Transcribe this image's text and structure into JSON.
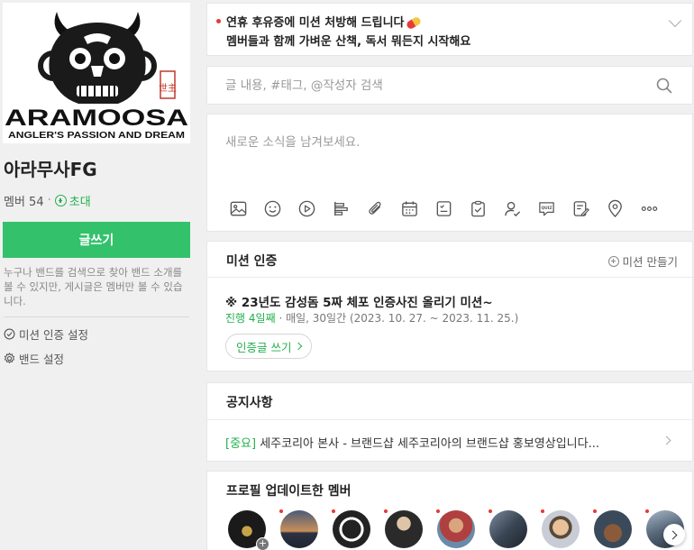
{
  "band": {
    "logo_text": "ARAMOOSA",
    "logo_tagline": "ANGLER'S PASSION AND DREAM",
    "logo_seal": "世主",
    "name": "아라무사FG",
    "member_label": "멤버 54",
    "invite_label": "초대",
    "write_button": "글쓰기",
    "description": "누구나 밴드를 검색으로 찾아 밴드 소개를 볼 수 있지만, 게시글은 멤버만 볼 수 있습니다.",
    "mission_setting": "미션 인증 설정",
    "band_setting": "밴드 설정"
  },
  "banner": {
    "line1": "연휴 후유증에 미션 처방해 드립니다",
    "line2": "멤버들과 함께 가벼운 산책, 독서 뭐든지 시작해요"
  },
  "search": {
    "placeholder": "글 내용, #태그, @작성자 검색"
  },
  "compose": {
    "placeholder": "새로운 소식을 남겨보세요.",
    "tools": [
      "image-icon",
      "emoji-icon",
      "video-icon",
      "poll-icon",
      "attach-icon",
      "calendar-icon",
      "todo-icon",
      "checklist-icon",
      "mention-icon",
      "quiz-icon",
      "memo-icon",
      "location-icon",
      "more-icon"
    ],
    "quiz_text": "QUIZ"
  },
  "mission": {
    "title": "미션 인증",
    "make_label": "미션 만들기",
    "item_title": "※ 23년도 감성돔 5짜 체포 인증사진 올리기 미션~",
    "progress": "진행 4일째",
    "schedule": "· 매일, 30일간 (2023. 10. 27. ~ 2023. 11. 25.)",
    "cert_button": "인증글 쓰기"
  },
  "notice": {
    "title": "공지사항",
    "tag": "[중요]",
    "text": " 세주코리아 본사 - 브랜드샵 세주코리아의 브랜드샵 홍보영상입니다..."
  },
  "profile": {
    "title": "프로필 업데이트한 멤버",
    "add_badge": "+"
  },
  "colors": {
    "accent_green": "#33c26b",
    "text_green": "#22b04c",
    "new_dot_red": "#e53935"
  }
}
